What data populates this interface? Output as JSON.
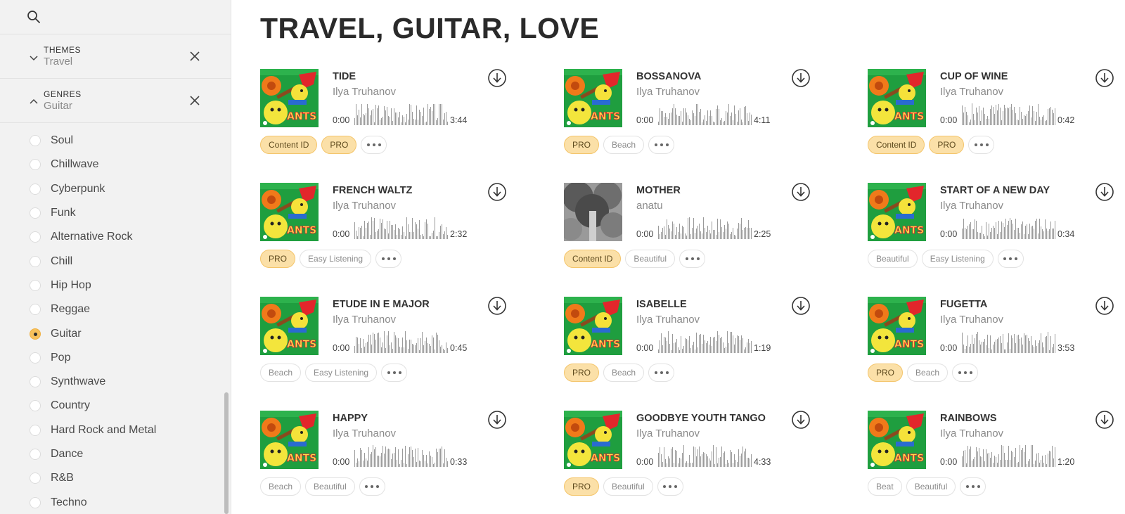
{
  "sidebar": {
    "filters": [
      {
        "name": "THEMES",
        "value": "Travel",
        "expanded": false
      },
      {
        "name": "GENRES",
        "value": "Guitar",
        "expanded": true
      }
    ],
    "genres": [
      "Soul",
      "Chillwave",
      "Cyberpunk",
      "Funk",
      "Alternative Rock",
      "Chill",
      "Hip Hop",
      "Reggae",
      "Guitar",
      "Pop",
      "Synthwave",
      "Country",
      "Hard Rock and Metal",
      "Dance",
      "R&B",
      "Techno"
    ],
    "selected_genre": "Guitar"
  },
  "page": {
    "title": "TRAVEL, GUITAR, LOVE"
  },
  "tracks": [
    {
      "title": "TIDE",
      "artist": "Ilya Truhanov",
      "start": "0:00",
      "duration": "3:44",
      "cover": "parrot",
      "tags": [
        {
          "label": "Content ID",
          "gold": true
        },
        {
          "label": "PRO",
          "gold": true
        }
      ]
    },
    {
      "title": "BOSSANOVA",
      "artist": "Ilya Truhanov",
      "start": "0:00",
      "duration": "4:11",
      "cover": "parrot",
      "tags": [
        {
          "label": "PRO",
          "gold": true
        },
        {
          "label": "Beach",
          "gold": false
        }
      ]
    },
    {
      "title": "CUP OF WINE",
      "artist": "Ilya Truhanov",
      "start": "0:00",
      "duration": "0:42",
      "cover": "parrot",
      "tags": [
        {
          "label": "Content ID",
          "gold": true
        },
        {
          "label": "PRO",
          "gold": true
        }
      ]
    },
    {
      "title": "FRENCH WALTZ",
      "artist": "Ilya Truhanov",
      "start": "0:00",
      "duration": "2:32",
      "cover": "parrot",
      "tags": [
        {
          "label": "PRO",
          "gold": true
        },
        {
          "label": "Easy Listening",
          "gold": false
        }
      ]
    },
    {
      "title": "MOTHER",
      "artist": "anatu",
      "start": "0:00",
      "duration": "2:25",
      "cover": "photo",
      "tags": [
        {
          "label": "Content ID",
          "gold": true
        },
        {
          "label": "Beautiful",
          "gold": false
        }
      ]
    },
    {
      "title": "START OF A NEW DAY",
      "artist": "Ilya Truhanov",
      "start": "0:00",
      "duration": "0:34",
      "cover": "parrot",
      "tags": [
        {
          "label": "Beautiful",
          "gold": false
        },
        {
          "label": "Easy Listening",
          "gold": false
        }
      ]
    },
    {
      "title": "ETUDE IN E MAJOR",
      "artist": "Ilya Truhanov",
      "start": "0:00",
      "duration": "0:45",
      "cover": "parrot",
      "tags": [
        {
          "label": "Beach",
          "gold": false
        },
        {
          "label": "Easy Listening",
          "gold": false
        }
      ]
    },
    {
      "title": "ISABELLE",
      "artist": "Ilya Truhanov",
      "start": "0:00",
      "duration": "1:19",
      "cover": "parrot",
      "tags": [
        {
          "label": "PRO",
          "gold": true
        },
        {
          "label": "Beach",
          "gold": false
        }
      ]
    },
    {
      "title": "FUGETTA",
      "artist": "Ilya Truhanov",
      "start": "0:00",
      "duration": "3:53",
      "cover": "parrot",
      "tags": [
        {
          "label": "PRO",
          "gold": true
        },
        {
          "label": "Beach",
          "gold": false
        }
      ]
    },
    {
      "title": "HAPPY",
      "artist": "Ilya Truhanov",
      "start": "0:00",
      "duration": "0:33",
      "cover": "parrot",
      "tags": [
        {
          "label": "Beach",
          "gold": false
        },
        {
          "label": "Beautiful",
          "gold": false
        }
      ]
    },
    {
      "title": "GOODBYE YOUTH TANGO",
      "artist": "Ilya Truhanov",
      "start": "0:00",
      "duration": "4:33",
      "cover": "parrot",
      "tags": [
        {
          "label": "PRO",
          "gold": true
        },
        {
          "label": "Beautiful",
          "gold": false
        }
      ]
    },
    {
      "title": "RAINBOWS",
      "artist": "Ilya Truhanov",
      "start": "0:00",
      "duration": "1:20",
      "cover": "parrot",
      "tags": [
        {
          "label": "Beat",
          "gold": false
        },
        {
          "label": "Beautiful",
          "gold": false
        }
      ]
    }
  ],
  "icons": {
    "search": "search-icon",
    "download": "download-icon",
    "more": "more-icon",
    "close": "close-icon"
  },
  "colors": {
    "accent": "#f7c15c",
    "tag_gold_bg": "#fbe0a8",
    "sidebar_bg": "#f2f2f2"
  }
}
